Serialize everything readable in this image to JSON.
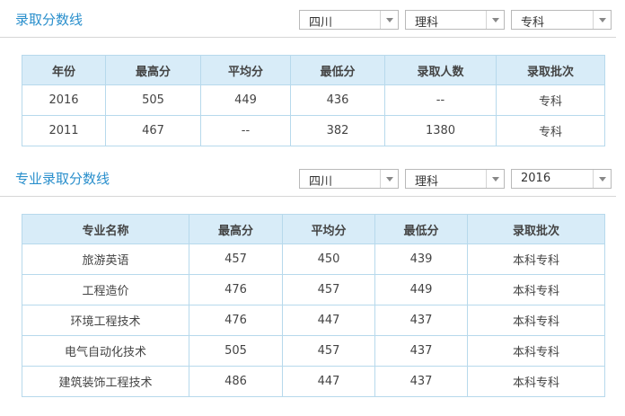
{
  "section1": {
    "title": "录取分数线",
    "filters": {
      "province": "四川",
      "subject": "理科",
      "level": "专科"
    },
    "headers": [
      "年份",
      "最高分",
      "平均分",
      "最低分",
      "录取人数",
      "录取批次"
    ],
    "rows": [
      [
        "2016",
        "505",
        "449",
        "436",
        "--",
        "专科"
      ],
      [
        "2011",
        "467",
        "--",
        "382",
        "1380",
        "专科"
      ]
    ]
  },
  "section2": {
    "title": "专业录取分数线",
    "filters": {
      "province": "四川",
      "subject": "理科",
      "year": "2016"
    },
    "headers": [
      "专业名称",
      "最高分",
      "平均分",
      "最低分",
      "录取批次"
    ],
    "rows": [
      [
        "旅游英语",
        "457",
        "450",
        "439",
        "本科专科"
      ],
      [
        "工程造价",
        "476",
        "457",
        "449",
        "本科专科"
      ],
      [
        "环境工程技术",
        "476",
        "447",
        "437",
        "本科专科"
      ],
      [
        "电气自动化技术",
        "505",
        "457",
        "437",
        "本科专科"
      ],
      [
        "建筑装饰工程技术",
        "486",
        "447",
        "437",
        "本科专科"
      ]
    ]
  }
}
